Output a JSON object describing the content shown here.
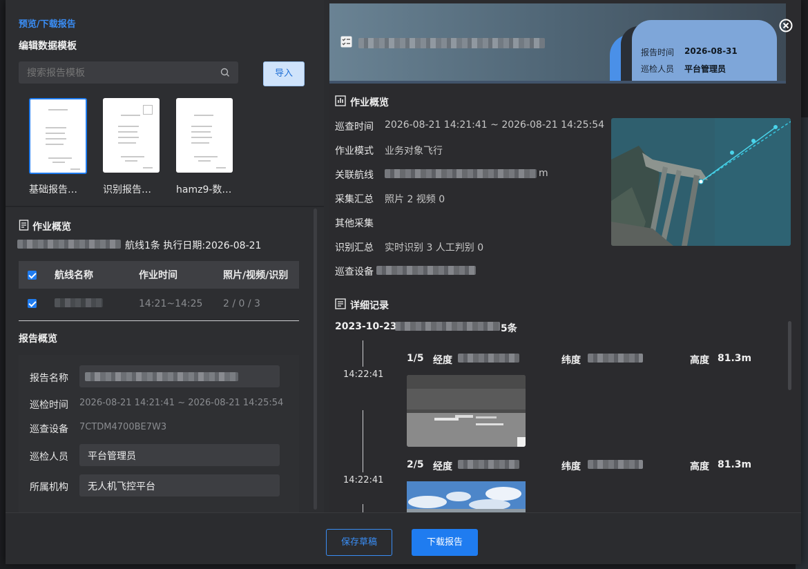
{
  "left": {
    "breadcrumb": "预览/下载报告",
    "subtitle": "编辑数据模板",
    "search": {
      "placeholder": "搜索报告模板"
    },
    "import_label": "导入",
    "templates": [
      {
        "name": "基础报告…"
      },
      {
        "name": "识别报告…"
      },
      {
        "name": "hamz9-数…"
      }
    ],
    "overview": {
      "title": "作业概览",
      "summary": "航线1条 执行日期:2026-08-21",
      "columns": [
        "航线名称",
        "作业时间",
        "照片/视频/识别"
      ],
      "rows": [
        {
          "time": "14:21~14:25",
          "counts": "2 / 0 / 3"
        }
      ]
    },
    "report": {
      "title": "报告概览",
      "name_label": "报告名称",
      "time_label": "巡检时间",
      "time_value": "2026-08-21 14:21:41 ~ 2026-08-21 14:25:54",
      "device_label": "巡查设备",
      "device_value": "7CTDM4700BE7W3",
      "person_label": "巡检人员",
      "person_value": "平台管理员",
      "org_label": "所属机构",
      "org_value": "无人机飞控平台"
    }
  },
  "right": {
    "header": {
      "report_time_label": "报告时间",
      "report_time_value": "2026-08-31",
      "inspector_label": "巡检人员",
      "inspector_value": "平台管理员"
    },
    "overview": {
      "title": "作业概览",
      "patrol_time_label": "巡查时间",
      "patrol_time_value": "2026-08-21 14:21:41 ~ 2026-08-21 14:25:54",
      "mode_label": "作业模式",
      "mode_value": "业务对象飞行",
      "route_label": "关联航线",
      "route_suffix": "m",
      "collect_label": "采集汇总",
      "collect_value": "照片 2 视频 0",
      "other_label": "其他采集",
      "recog_label": "识别汇总",
      "recog_value": "实时识别 3 人工判别 0",
      "device_label": "巡查设备"
    },
    "detail": {
      "title": "详细记录",
      "date": "2023-10-23",
      "count_suffix": "5条",
      "records": [
        {
          "index": "1/5",
          "lng_label": "经度",
          "lat_label": "纬度",
          "alt_label": "高度",
          "alt_value": "81.3m",
          "time": "14:22:41"
        },
        {
          "index": "2/5",
          "lng_label": "经度",
          "lat_label": "纬度",
          "alt_label": "高度",
          "alt_value": "81.3m",
          "time": "14:22:41"
        }
      ]
    }
  },
  "footer": {
    "save_draft": "保存草稿",
    "download": "下载报告"
  },
  "colors": {
    "accent": "#1f7cf0",
    "link": "#3a8ef6"
  }
}
